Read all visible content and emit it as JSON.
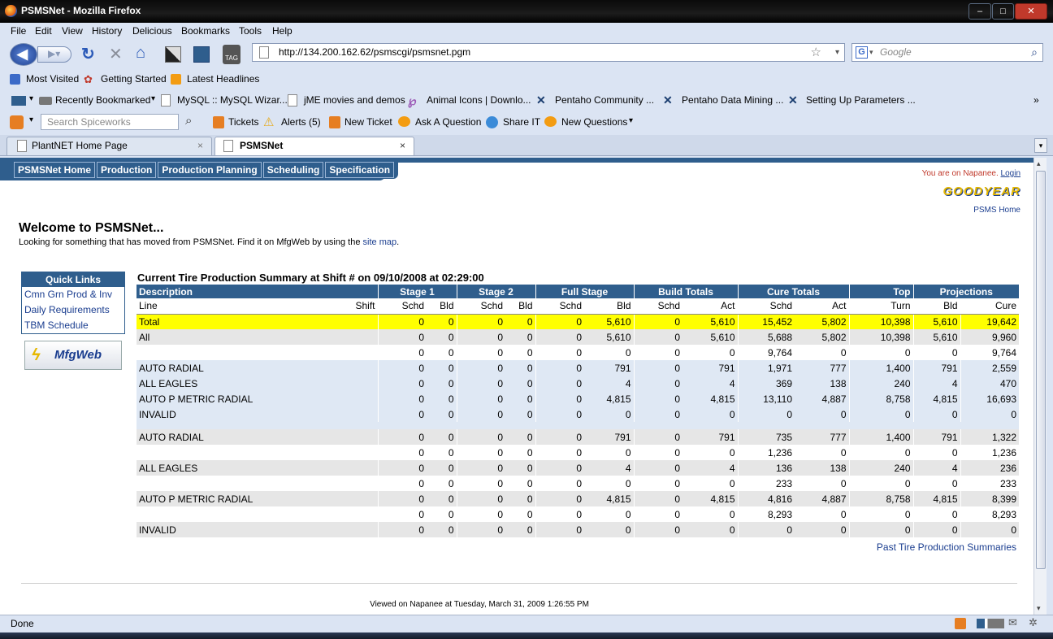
{
  "window": {
    "title": "PSMSNet - Mozilla Firefox"
  },
  "menubar": [
    "File",
    "Edit",
    "View",
    "History",
    "Delicious",
    "Bookmarks",
    "Tools",
    "Help"
  ],
  "address": {
    "url": "http://134.200.162.62/psmscgi/psmsnet.pgm",
    "search_placeholder": "Google"
  },
  "bookmarks1": [
    "Most Visited",
    "Getting Started",
    "Latest Headlines"
  ],
  "bookmarks2": [
    "Recently Bookmarked",
    "MySQL :: MySQL Wizar...",
    "jME movies and demos",
    "Animal Icons | Downlo...",
    "Pentaho Community ...",
    "Pentaho Data Mining ...",
    "Setting Up Parameters ..."
  ],
  "toolbar3": {
    "search_placeholder": "Search Spiceworks",
    "items": [
      "Tickets",
      "Alerts (5)",
      "New Ticket",
      "Ask A Question",
      "Share IT",
      "New Questions"
    ]
  },
  "tabs": [
    {
      "label": "PlantNET Home Page"
    },
    {
      "label": "PSMSNet"
    }
  ],
  "page": {
    "nav": [
      "PSMSNet Home",
      "Production",
      "Production Planning",
      "Scheduling",
      "Specification"
    ],
    "location_text": "You are on Napanee.",
    "login": "Login",
    "logo": "GOODYEAR",
    "psms_home": "PSMS Home",
    "welcome": "Welcome to PSMSNet...",
    "look_text": "Looking for something that has moved from PSMSNet. Find it on MfgWeb by using the",
    "site_map": "site map",
    "quick_links": {
      "title": "Quick Links",
      "items": [
        "Cmn Grn Prod & Inv",
        "Daily Requirements",
        "TBM Schedule"
      ]
    },
    "mfgweb": "MfgWeb",
    "summary_title": "Current Tire Production Summary at Shift # on 09/10/2008 at 02:29:00",
    "group_headers": [
      "Description",
      "Stage 1",
      "Stage 2",
      "Full Stage",
      "Build Totals",
      "Cure Totals",
      "Top",
      "Projections"
    ],
    "sub_headers": [
      "Line",
      "Shift",
      "Schd",
      "Bld",
      "Schd",
      "Bld",
      "Schd",
      "Bld",
      "Schd",
      "Act",
      "Schd",
      "Act",
      "Turn",
      "Bld",
      "Cure"
    ],
    "rows": [
      {
        "s": "y",
        "c": [
          "Total",
          "",
          "0",
          "0",
          "0",
          "0",
          "0",
          "5,610",
          "0",
          "5,610",
          "15,452",
          "5,802",
          "10,398",
          "5,610",
          "19,642"
        ]
      },
      {
        "s": "g",
        "c": [
          "All",
          "",
          "0",
          "0",
          "0",
          "0",
          "0",
          "5,610",
          "0",
          "5,610",
          "5,688",
          "5,802",
          "10,398",
          "5,610",
          "9,960"
        ]
      },
      {
        "s": "w",
        "c": [
          "",
          "",
          "0",
          "0",
          "0",
          "0",
          "0",
          "0",
          "0",
          "0",
          "9,764",
          "0",
          "0",
          "0",
          "9,764"
        ]
      },
      {
        "s": "b",
        "c": [
          "AUTO RADIAL",
          "",
          "0",
          "0",
          "0",
          "0",
          "0",
          "791",
          "0",
          "791",
          "1,971",
          "777",
          "1,400",
          "791",
          "2,559"
        ]
      },
      {
        "s": "b",
        "c": [
          "ALL EAGLES",
          "",
          "0",
          "0",
          "0",
          "0",
          "0",
          "4",
          "0",
          "4",
          "369",
          "138",
          "240",
          "4",
          "470"
        ]
      },
      {
        "s": "b",
        "c": [
          "AUTO P METRIC RADIAL",
          "",
          "0",
          "0",
          "0",
          "0",
          "0",
          "4,815",
          "0",
          "4,815",
          "13,110",
          "4,887",
          "8,758",
          "4,815",
          "16,693"
        ]
      },
      {
        "s": "b",
        "c": [
          "INVALID",
          "",
          "0",
          "0",
          "0",
          "0",
          "0",
          "0",
          "0",
          "0",
          "0",
          "0",
          "0",
          "0",
          "0"
        ]
      },
      {
        "s": "g",
        "c": [
          "AUTO RADIAL",
          "",
          "0",
          "0",
          "0",
          "0",
          "0",
          "791",
          "0",
          "791",
          "735",
          "777",
          "1,400",
          "791",
          "1,322"
        ]
      },
      {
        "s": "w",
        "c": [
          "",
          "",
          "0",
          "0",
          "0",
          "0",
          "0",
          "0",
          "0",
          "0",
          "1,236",
          "0",
          "0",
          "0",
          "1,236"
        ]
      },
      {
        "s": "g",
        "c": [
          "ALL EAGLES",
          "",
          "0",
          "0",
          "0",
          "0",
          "0",
          "4",
          "0",
          "4",
          "136",
          "138",
          "240",
          "4",
          "236"
        ]
      },
      {
        "s": "w",
        "c": [
          "",
          "",
          "0",
          "0",
          "0",
          "0",
          "0",
          "0",
          "0",
          "0",
          "233",
          "0",
          "0",
          "0",
          "233"
        ]
      },
      {
        "s": "g",
        "c": [
          "AUTO P METRIC RADIAL",
          "",
          "0",
          "0",
          "0",
          "0",
          "0",
          "4,815",
          "0",
          "4,815",
          "4,816",
          "4,887",
          "8,758",
          "4,815",
          "8,399"
        ]
      },
      {
        "s": "w",
        "c": [
          "",
          "",
          "0",
          "0",
          "0",
          "0",
          "0",
          "0",
          "0",
          "0",
          "8,293",
          "0",
          "0",
          "0",
          "8,293"
        ]
      },
      {
        "s": "g",
        "c": [
          "INVALID",
          "",
          "0",
          "0",
          "0",
          "0",
          "0",
          "0",
          "0",
          "0",
          "0",
          "0",
          "0",
          "0",
          "0"
        ]
      }
    ],
    "past_link": "Past Tire Production Summaries",
    "viewed": "Viewed on Napanee at Tuesday, March 31, 2009 1:26:55 PM"
  },
  "status": "Done"
}
